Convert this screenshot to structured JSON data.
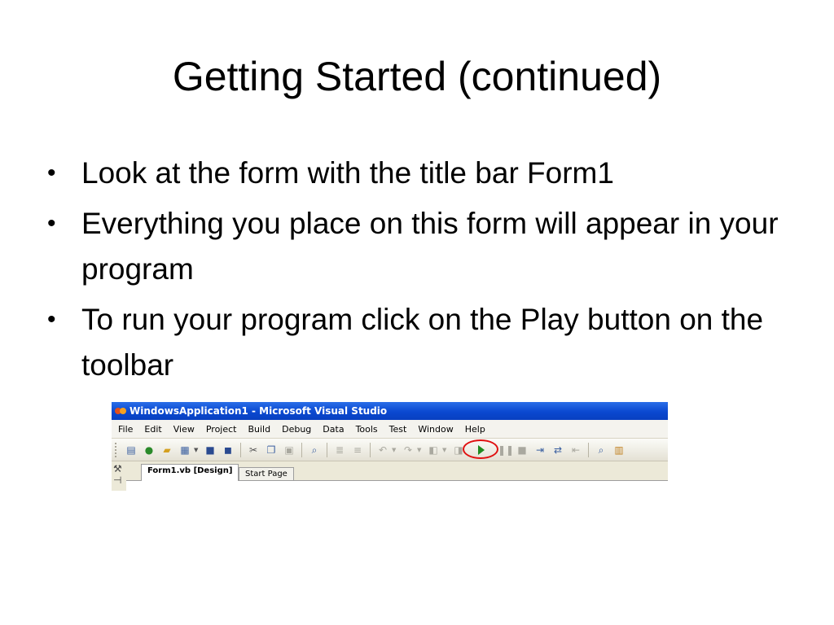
{
  "slide": {
    "title": "Getting Started (continued)",
    "bullets": [
      "Look at the form with the title bar Form1",
      "Everything you place on this form will appear in your program",
      "To run your program click on the Play button on the toolbar"
    ],
    "bullet_symbol": "•"
  },
  "screenshot": {
    "window_title": "WindowsApplication1 - Microsoft Visual Studio",
    "menu": [
      "File",
      "Edit",
      "View",
      "Project",
      "Build",
      "Debug",
      "Data",
      "Tools",
      "Test",
      "Window",
      "Help"
    ],
    "tabs": [
      "Form1.vb [Design]",
      "Start Page"
    ],
    "highlight_color": "#e01010",
    "play_icon": "play-icon"
  }
}
